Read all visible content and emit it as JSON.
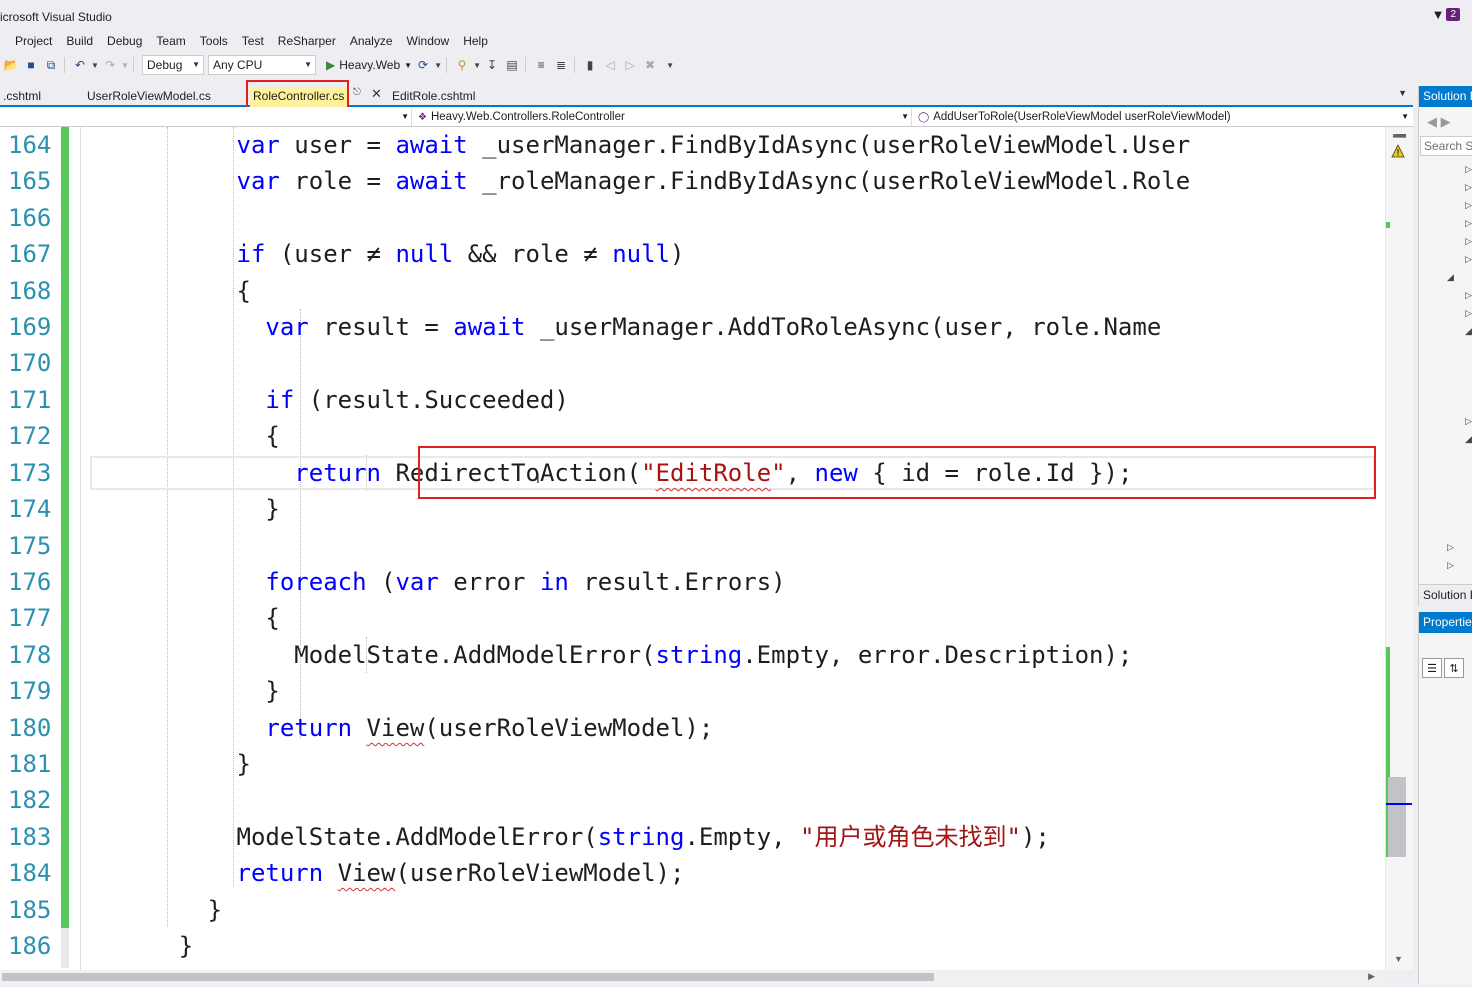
{
  "window": {
    "title": "icrosoft Visual Studio",
    "notification_count": "2"
  },
  "menu": [
    "Project",
    "Build",
    "Debug",
    "Team",
    "Tools",
    "Test",
    "ReSharper",
    "Analyze",
    "Window",
    "Help"
  ],
  "toolbar": {
    "configuration": "Debug",
    "platform": "Any CPU",
    "startup_project": "Heavy.Web"
  },
  "tabs": [
    {
      "label": ".cshtml",
      "active": false
    },
    {
      "label": "UserRoleViewModel.cs",
      "active": false
    },
    {
      "label": "RoleController.cs",
      "active": true
    },
    {
      "label": "EditRole.cshtml",
      "active": false
    }
  ],
  "navbar": {
    "project": "",
    "type": "Heavy.Web.Controllers.RoleController",
    "member": "AddUserToRole(UserRoleViewModel userRoleViewModel)"
  },
  "line_numbers": [
    "164",
    "165",
    "166",
    "167",
    "168",
    "169",
    "170",
    "171",
    "172",
    "173",
    "174",
    "175",
    "176",
    "177",
    "178",
    "179",
    "180",
    "181",
    "182",
    "183",
    "184",
    "185",
    "186"
  ],
  "code": {
    "l164": [
      "var",
      " user = ",
      "await",
      " _userManager.FindByIdAsync(userRoleViewModel.User"
    ],
    "l165": [
      "var",
      " role = ",
      "await",
      " _roleManager.FindByIdAsync(userRoleViewModel.Role"
    ],
    "l167": [
      "if",
      " (user ≠ ",
      "null",
      " && role ≠ ",
      "null",
      ")"
    ],
    "l168": "{",
    "l169": [
      "var",
      " result = ",
      "await",
      " _userManager.AddToRoleAsync(user, role.Name"
    ],
    "l171": [
      "if",
      " (result.Succeeded)"
    ],
    "l172": "{",
    "l173": [
      "return",
      " ",
      "RedirectToAction",
      "(",
      "\"",
      "EditRole",
      "\"",
      ", ",
      "new",
      " { id = role.Id });"
    ],
    "l174": "}",
    "l176": [
      "foreach",
      " (",
      "var",
      " error ",
      "in",
      " result.Errors)"
    ],
    "l177": "{",
    "l178": [
      "ModelState.AddModelError(",
      "string",
      ".Empty, error.Description);"
    ],
    "l179": "}",
    "l180": [
      "return",
      " ",
      "View",
      "(userRoleViewModel);"
    ],
    "l181": "}",
    "l183": [
      "ModelState.AddModelError(",
      "string",
      ".Empty, ",
      "\"用户或角色未找到\"",
      ");"
    ],
    "l184": [
      "return",
      " ",
      "View",
      "(userRoleViewModel);"
    ],
    "l185": "}",
    "l186": "}"
  },
  "solution_panel": {
    "title": "Solution E",
    "search_placeholder": "Search Sc",
    "footer": "Solution E"
  },
  "properties_panel": {
    "title": "Properties"
  },
  "colors": {
    "keyword": "#0000ff",
    "string": "#a31515",
    "line_number": "#2b91af",
    "change_bar": "#57c85b",
    "accent": "#007acc",
    "highlight_box": "#e02020"
  }
}
